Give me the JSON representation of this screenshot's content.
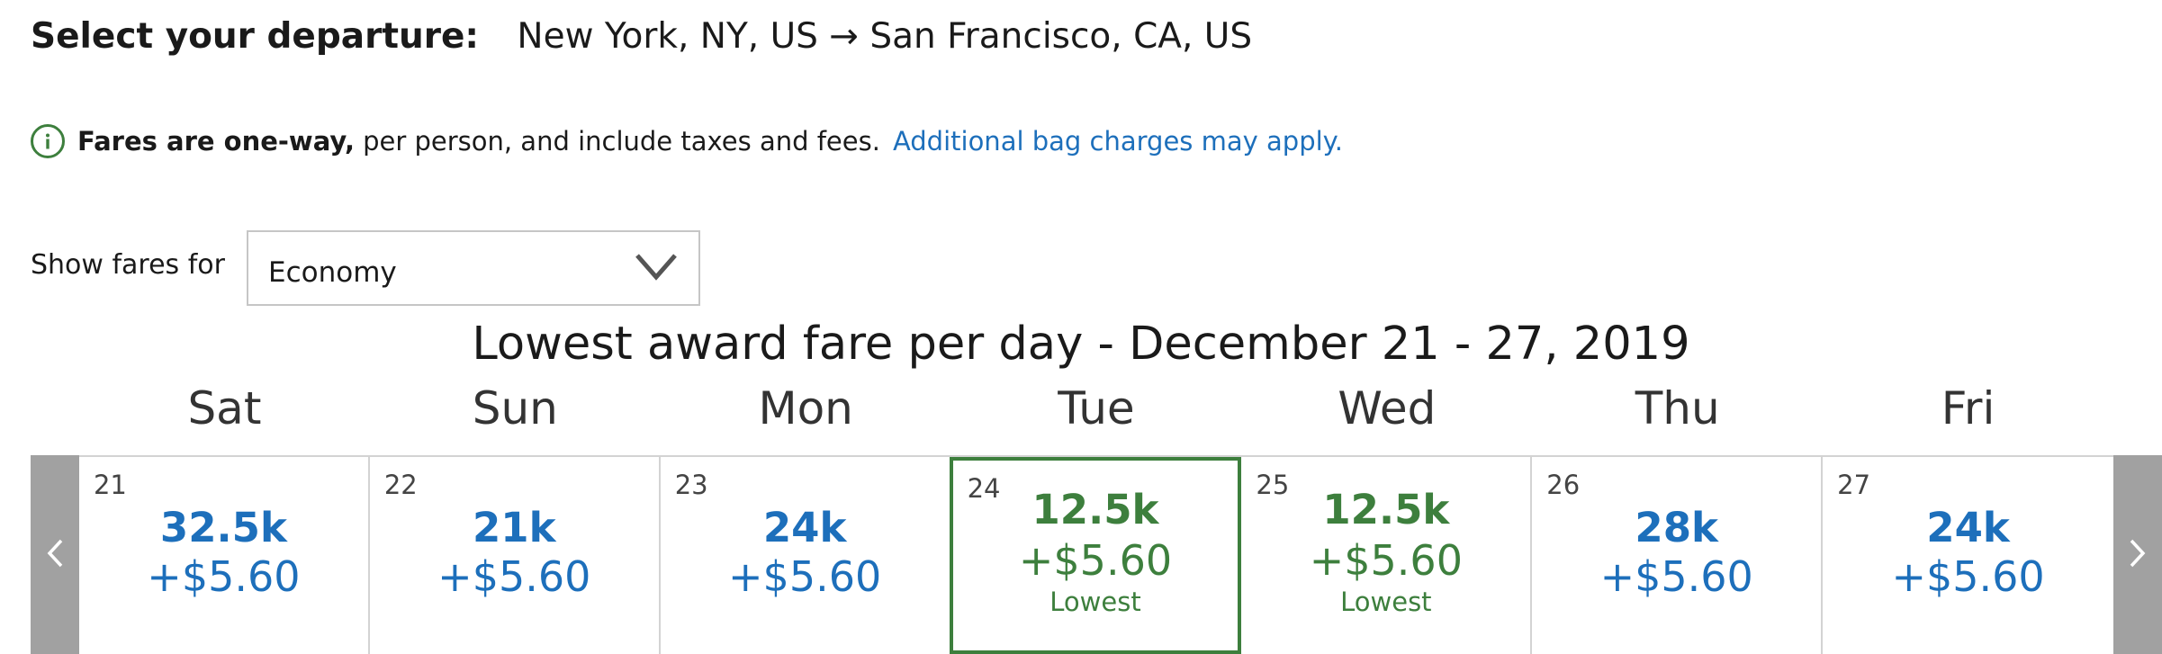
{
  "header": {
    "label": "Select your departure:",
    "route": "New York, NY, US → San Francisco, CA, US"
  },
  "notice": {
    "icon": "info-icon",
    "bold": "Fares are one-way,",
    "text": "per person, and include taxes and fees.",
    "link": "Additional bag charges may apply."
  },
  "fares": {
    "label": "Show fares for",
    "selected": "Economy"
  },
  "calendar": {
    "title": "Lowest award fare per day - December 21 - 27, 2019",
    "prev_icon": "chevron-left-icon",
    "next_icon": "chevron-right-icon",
    "days": [
      {
        "name": "Sat",
        "date": "21",
        "miles": "32.5k",
        "fee": "+$5.60",
        "note": ""
      },
      {
        "name": "Sun",
        "date": "22",
        "miles": "21k",
        "fee": "+$5.60",
        "note": ""
      },
      {
        "name": "Mon",
        "date": "23",
        "miles": "24k",
        "fee": "+$5.60",
        "note": ""
      },
      {
        "name": "Tue",
        "date": "24",
        "miles": "12.5k",
        "fee": "+$5.60",
        "note": "Lowest"
      },
      {
        "name": "Wed",
        "date": "25",
        "miles": "12.5k",
        "fee": "+$5.60",
        "note": "Lowest"
      },
      {
        "name": "Thu",
        "date": "26",
        "miles": "28k",
        "fee": "+$5.60",
        "note": ""
      },
      {
        "name": "Fri",
        "date": "27",
        "miles": "24k",
        "fee": "+$5.60",
        "note": ""
      }
    ],
    "selected_date": "24"
  },
  "colors": {
    "link_blue": "#1d6fbb",
    "lowest_green": "#3d7f3d",
    "nav_gray": "#a1a1a1"
  }
}
